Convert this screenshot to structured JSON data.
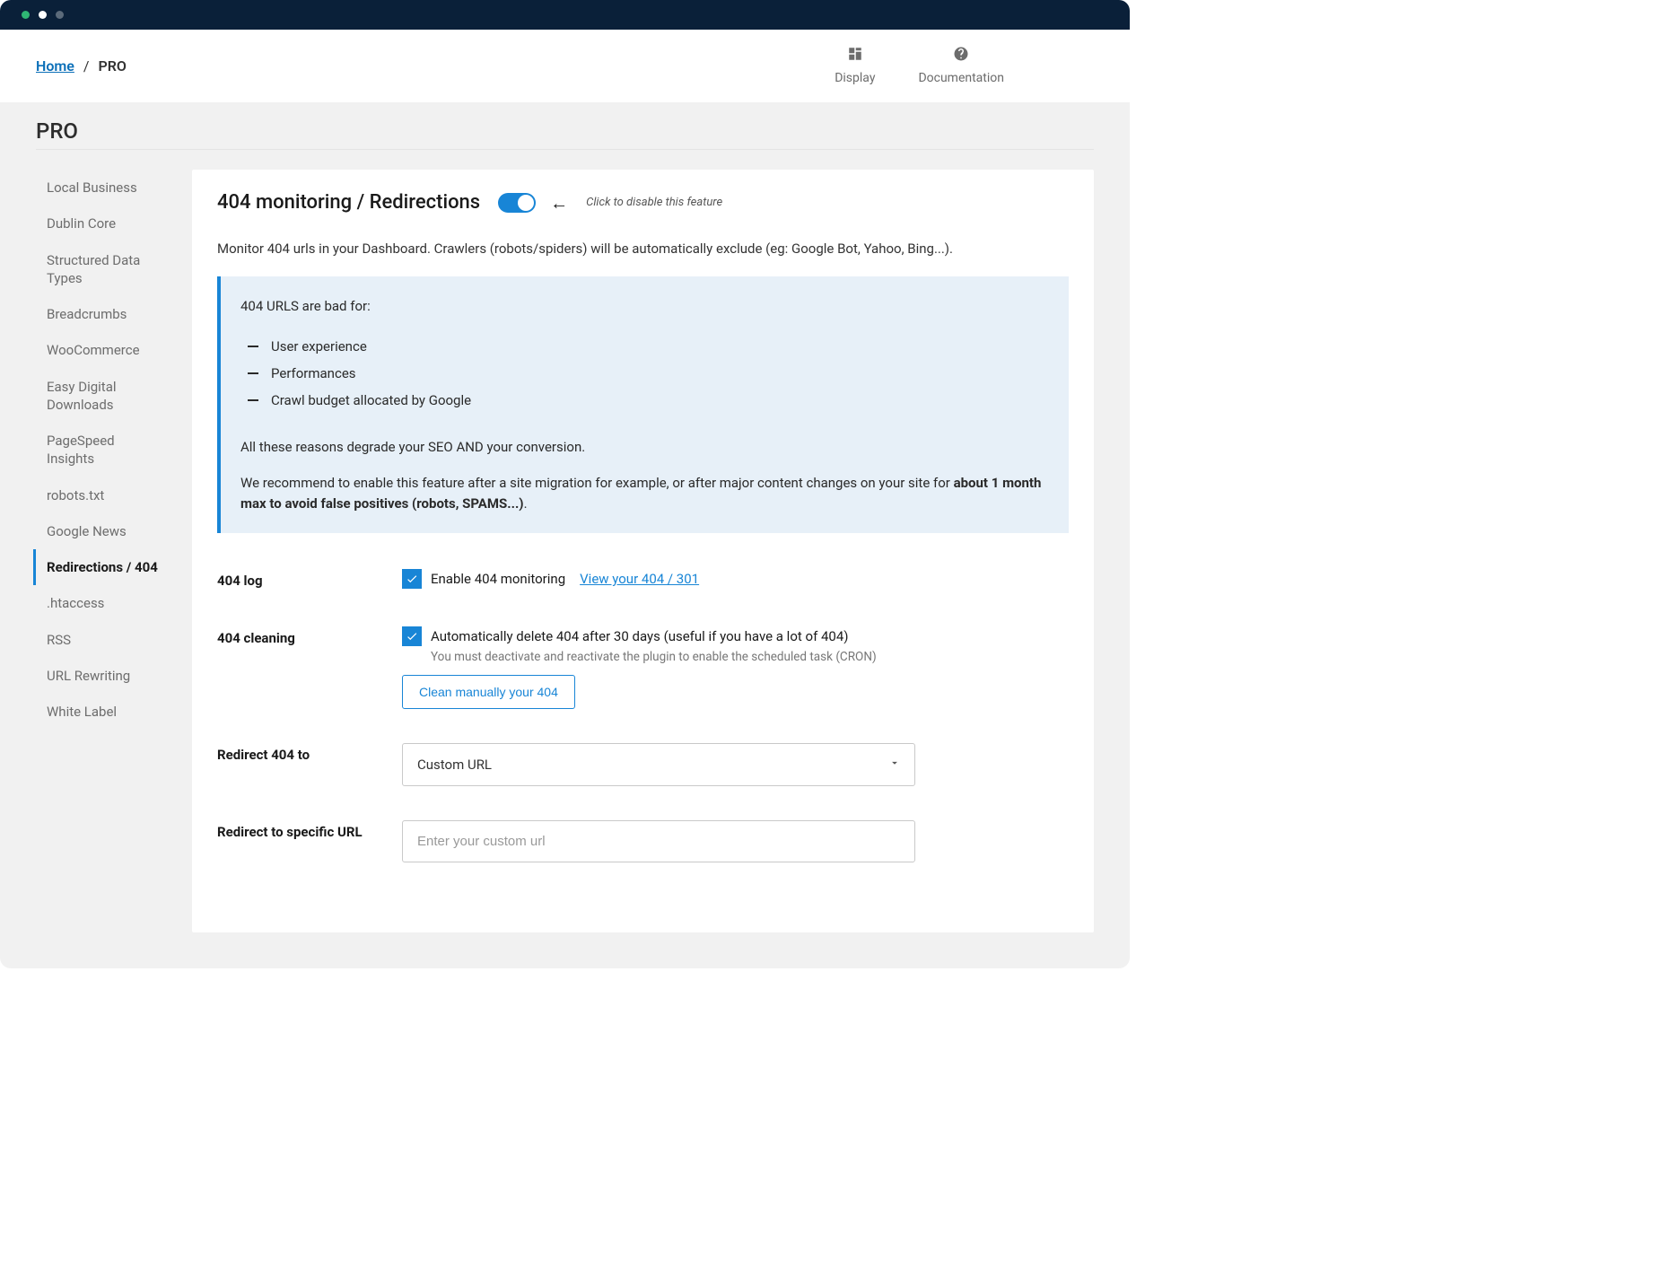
{
  "breadcrumb": {
    "home": "Home",
    "current": "PRO"
  },
  "topline": {
    "display": "Display",
    "documentation": "Documentation"
  },
  "page_title": "PRO",
  "sidebar": {
    "items": [
      {
        "label": "Local Business"
      },
      {
        "label": "Dublin Core"
      },
      {
        "label": "Structured Data Types"
      },
      {
        "label": "Breadcrumbs"
      },
      {
        "label": "WooCommerce"
      },
      {
        "label": "Easy Digital Downloads"
      },
      {
        "label": "PageSpeed Insights"
      },
      {
        "label": "robots.txt"
      },
      {
        "label": "Google News"
      },
      {
        "label": "Redirections / 404"
      },
      {
        "label": ".htaccess"
      },
      {
        "label": "RSS"
      },
      {
        "label": "URL Rewriting"
      },
      {
        "label": "White Label"
      }
    ],
    "active_index": 9
  },
  "panel": {
    "heading": "404 monitoring / Redirections",
    "toggle_on": true,
    "disable_hint": "Click to disable this feature",
    "intro": "Monitor 404 urls in your Dashboard. Crawlers (robots/spiders) will be automatically exclude (eg: Google Bot, Yahoo, Bing...).",
    "callout": {
      "lead": "404 URLS are bad for:",
      "items": [
        "User experience",
        "Performances",
        "Crawl budget allocated by Google"
      ],
      "line2": "All these reasons degrade your SEO AND your conversion.",
      "line3_prefix": "We recommend to enable this feature after a site migration for example, or after major content changes on your site for ",
      "line3_bold": "about 1 month max to avoid false positives (robots, SPAMS...)",
      "line3_suffix": "."
    },
    "rows": {
      "log": {
        "label": "404 log",
        "check_label": "Enable 404 monitoring",
        "link": "View your 404 / 301"
      },
      "cleaning": {
        "label": "404 cleaning",
        "check_label": "Automatically delete 404 after 30 days (useful if you have a lot of 404)",
        "helper": "You must deactivate and reactivate the plugin to enable the scheduled task (CRON)",
        "button": "Clean manually your 404"
      },
      "redirect_to": {
        "label": "Redirect 404 to",
        "selected": "Custom URL"
      },
      "specific": {
        "label": "Redirect to specific URL",
        "placeholder": "Enter your custom url",
        "value": ""
      }
    }
  }
}
